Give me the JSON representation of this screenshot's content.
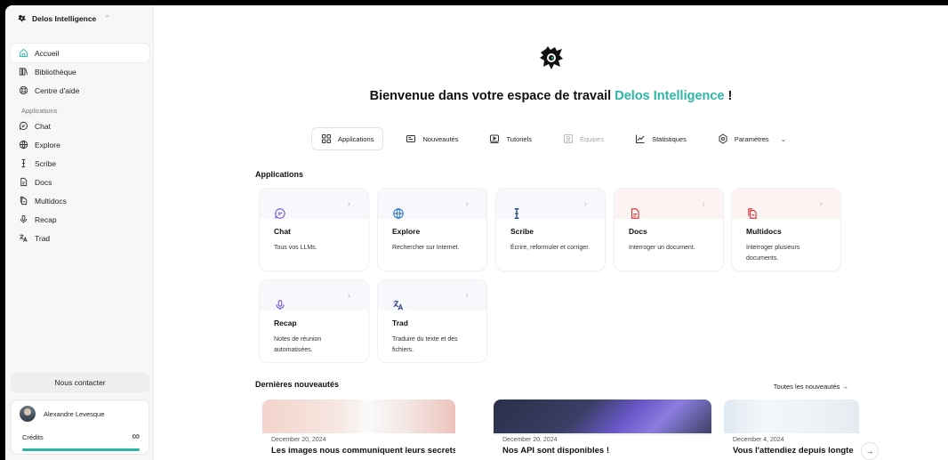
{
  "workspace": {
    "name": "Delos Intelligence",
    "switch_icon": "chevron-updown-icon"
  },
  "sidebar": {
    "main_items": [
      {
        "label": "Accueil",
        "icon": "home-icon",
        "active": true
      },
      {
        "label": "Bibliothèque",
        "icon": "library-icon"
      },
      {
        "label": "Centre d'aide",
        "icon": "help-icon"
      }
    ],
    "apps_label": "Applications",
    "app_items": [
      {
        "label": "Chat",
        "icon": "chat-icon"
      },
      {
        "label": "Explore",
        "icon": "globe-icon"
      },
      {
        "label": "Scribe",
        "icon": "text-cursor-icon"
      },
      {
        "label": "Docs",
        "icon": "document-icon"
      },
      {
        "label": "Multidocs",
        "icon": "documents-icon"
      },
      {
        "label": "Recap",
        "icon": "microphone-icon"
      },
      {
        "label": "Trad",
        "icon": "translate-icon"
      }
    ],
    "contact_label": "Nous contacter",
    "user": {
      "name": "Alexandre Levesque",
      "credits_label": "Crédits",
      "credits_value": "∞"
    }
  },
  "headline": {
    "prefix": "Bienvenue dans votre espace de travail ",
    "brand": "Delos Intelligence",
    "suffix": " !"
  },
  "tabs": [
    {
      "label": "Applications",
      "icon": "grid-icon",
      "active": true
    },
    {
      "label": "Nouveautés",
      "icon": "news-icon"
    },
    {
      "label": "Tutoriels",
      "icon": "video-icon"
    },
    {
      "label": "Équipes",
      "icon": "team-icon",
      "disabled": true
    },
    {
      "label": "Statistiques",
      "icon": "chart-icon"
    },
    {
      "label": "Paramètres",
      "icon": "settings-icon",
      "dropdown": true
    }
  ],
  "applications": {
    "title": "Applications",
    "cards": [
      {
        "title": "Chat",
        "desc": "Tous vos LLMs.",
        "icon": "chat-icon",
        "color": "#7b5bd6"
      },
      {
        "title": "Explore",
        "desc": "Rechercher sur Internet.",
        "icon": "globe-icon",
        "color": "#3b82c4"
      },
      {
        "title": "Scribe",
        "desc": "Écrire, reformuler et corriger.",
        "icon": "text-cursor-icon",
        "color": "#2f4a8a"
      },
      {
        "title": "Docs",
        "desc": "Interroger un document.",
        "icon": "document-icon",
        "color": "#d63b3b"
      },
      {
        "title": "Multidocs",
        "desc": "Interroger plusieurs documents.",
        "icon": "documents-icon",
        "color": "#d63b3b"
      },
      {
        "title": "Recap",
        "desc": "Notes de réunion automatisées.",
        "icon": "microphone-icon",
        "color": "#7b5bd6"
      },
      {
        "title": "Trad",
        "desc": "Traduire du texte et des fichiers.",
        "icon": "translate-icon",
        "color": "#3b4a8a"
      }
    ]
  },
  "news": {
    "title": "Dernières nouveautés",
    "all_link": "Toutes les nouveautés →",
    "items": [
      {
        "date": "December 20, 2024",
        "title": "Les images nous communiquent leurs secrets"
      },
      {
        "date": "December 20, 2024",
        "title": "Nos API sont disponibles !"
      },
      {
        "date": "December 4, 2024",
        "title": "Vous l'attendiez depuis longte"
      }
    ]
  },
  "colors": {
    "accent": "#2bb6a6",
    "sidebar_bg": "#f7f7f7"
  }
}
